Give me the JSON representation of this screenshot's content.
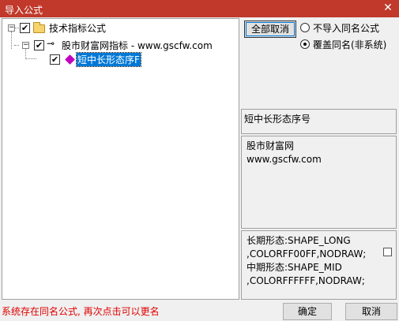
{
  "window": {
    "title": "导入公式",
    "close_glyph": "✕"
  },
  "tree": {
    "root": {
      "label": "技术指标公式",
      "checked": true
    },
    "group": {
      "label": "股市财富网指标 - www.gscfw.com",
      "checked": true
    },
    "item": {
      "label": "短中长形态序F",
      "checked": true,
      "selected": true
    }
  },
  "buttons": {
    "cancel_all": "全部取消",
    "ok": "确定",
    "cancel": "取消"
  },
  "options": {
    "no_import": "不导入同名公式",
    "overwrite": "覆盖同名(非系统)",
    "selected": "overwrite"
  },
  "info": {
    "name": "短中长形态序号",
    "source_lines": [
      "股市财富网",
      "www.gscfw.com"
    ],
    "code_lines": [
      "长期形态:SHAPE_LONG",
      ",COLORFF00FF,NODRAW;",
      "中期形态:SHAPE_MID",
      ",COLORFFFFFF,NODRAW;"
    ]
  },
  "status_text": "系统存在同名公式, 再次点击可以更名",
  "colors": {
    "titlebar": "#c0392b",
    "selection": "#0078d7",
    "status": "#e00000",
    "gem": "#c000c0"
  }
}
